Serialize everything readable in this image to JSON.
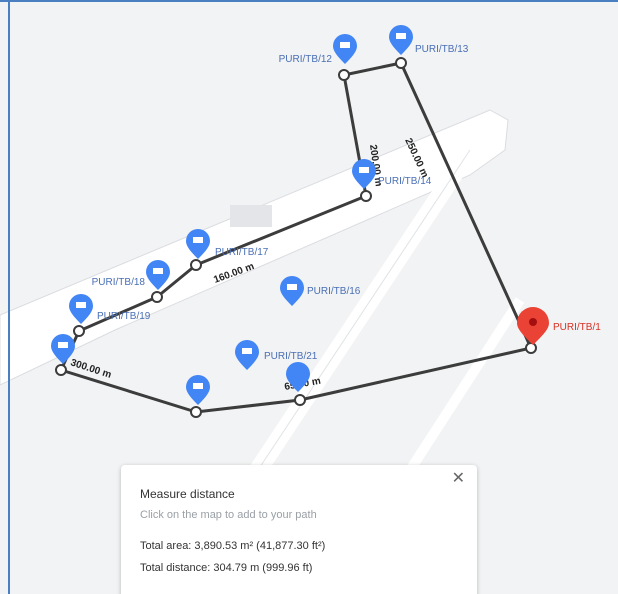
{
  "map": {
    "pins": [
      {
        "label": "PURI/TB/12",
        "color": "#4285f4"
      },
      {
        "label": "PURI/TB/13",
        "color": "#4285f4"
      },
      {
        "label": "PURI/TB/14",
        "color": "#4285f4"
      },
      {
        "label": "PURI/TB/17",
        "color": "#4285f4"
      },
      {
        "label": "PURI/TB/18",
        "color": "#4285f4"
      },
      {
        "label": "PURI/TB/19",
        "color": "#4285f4"
      },
      {
        "label": "PURI/TB/16",
        "color": "#4285f4"
      },
      {
        "label": "PURI/TB/21",
        "color": "#4285f4"
      },
      {
        "label": "PURI/TB/1",
        "color": "#ea4335"
      }
    ],
    "distance_labels": [
      "200.00 m",
      "250.00 m",
      "160.00 m",
      "300.00 m",
      "65.00 m"
    ]
  },
  "measure_panel": {
    "title": "Measure distance",
    "hint": "Click on the map to add to your path",
    "total_area": "Total area: 3,890.53 m² (41,877.30 ft²)",
    "total_distance": "Total distance: 304.79 m (999.96 ft)",
    "close_icon": "close-icon"
  },
  "colors": {
    "path": "#3c3c3c",
    "pin_blue": "#4285f4",
    "pin_red": "#ea4335",
    "frame_border": "#4a7fc1",
    "road": "#ffffff",
    "background": "#f1f3f4"
  }
}
